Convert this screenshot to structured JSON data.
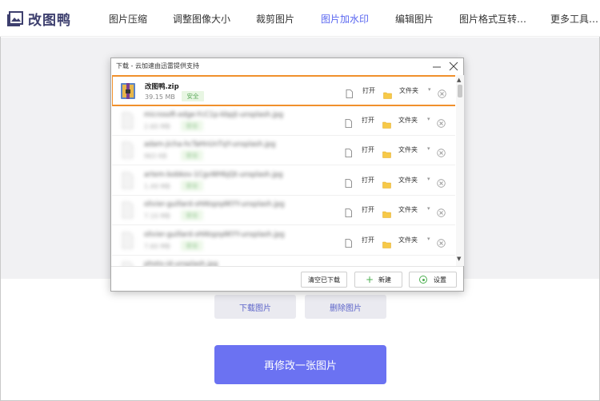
{
  "nav": {
    "logo_text": "改图鸭",
    "items": [
      "图片压缩",
      "调整图像大小",
      "裁剪图片",
      "图片加水印",
      "编辑图片",
      "图片格式互转…",
      "更多工具…"
    ],
    "active_index": 3
  },
  "page": {
    "download_label": "下载图片",
    "delete_label": "删除图片",
    "redo_label": "再修改一张图片"
  },
  "dialog": {
    "title": "下载 - 云加速由迅雷提供支持",
    "rows": [
      {
        "name": "改图鸭.zip",
        "size": "39.15 MB",
        "badge": "安全",
        "open": "打开",
        "folder": "文件夹",
        "blurred": false,
        "icon": "zip-archive-icon"
      },
      {
        "name": "microsoft-edge-YcC1p-kbpjt-unsplash.jpg",
        "size": "2.60 MB",
        "badge": "安全",
        "open": "打开",
        "folder": "文件夹",
        "blurred": true,
        "icon": "file-icon"
      },
      {
        "name": "adam-jicha-hcTaHnUnTqY-unsplash.jpg",
        "size": "963 KB",
        "badge": "安全",
        "open": "打开",
        "folder": "文件夹",
        "blurred": true,
        "icon": "file-icon"
      },
      {
        "name": "artem-bobkov-1CgvWHbjQt-unsplash.jpg",
        "size": "1.49 MB",
        "badge": "安全",
        "open": "打开",
        "folder": "文件夹",
        "blurred": true,
        "icon": "file-icon"
      },
      {
        "name": "olivier-guillard-sHAtqzq4KYY-unsplash.jpg",
        "size": "7.10 MB",
        "badge": "安全",
        "open": "打开",
        "folder": "文件夹",
        "blurred": true,
        "icon": "file-icon"
      },
      {
        "name": "olivier-guillard-sHAtqzq4KYY-unsplash.jpg",
        "size": "7.60 MB",
        "badge": "安全",
        "open": "打开",
        "folder": "文件夹",
        "blurred": true,
        "icon": "file-icon"
      },
      {
        "name": "photo-id-unsplash.jpg",
        "size": "",
        "badge": "",
        "open": "",
        "folder": "",
        "blurred": true,
        "icon": "file-icon"
      }
    ],
    "footer": {
      "clear_label": "清空已下载",
      "new_label": "新建",
      "settings_label": "设置"
    }
  },
  "colors": {
    "accent": "#6b72f2",
    "nav_active": "#5a67f0",
    "highlight_border": "#f0902c",
    "safe_green": "#5aa85a"
  }
}
